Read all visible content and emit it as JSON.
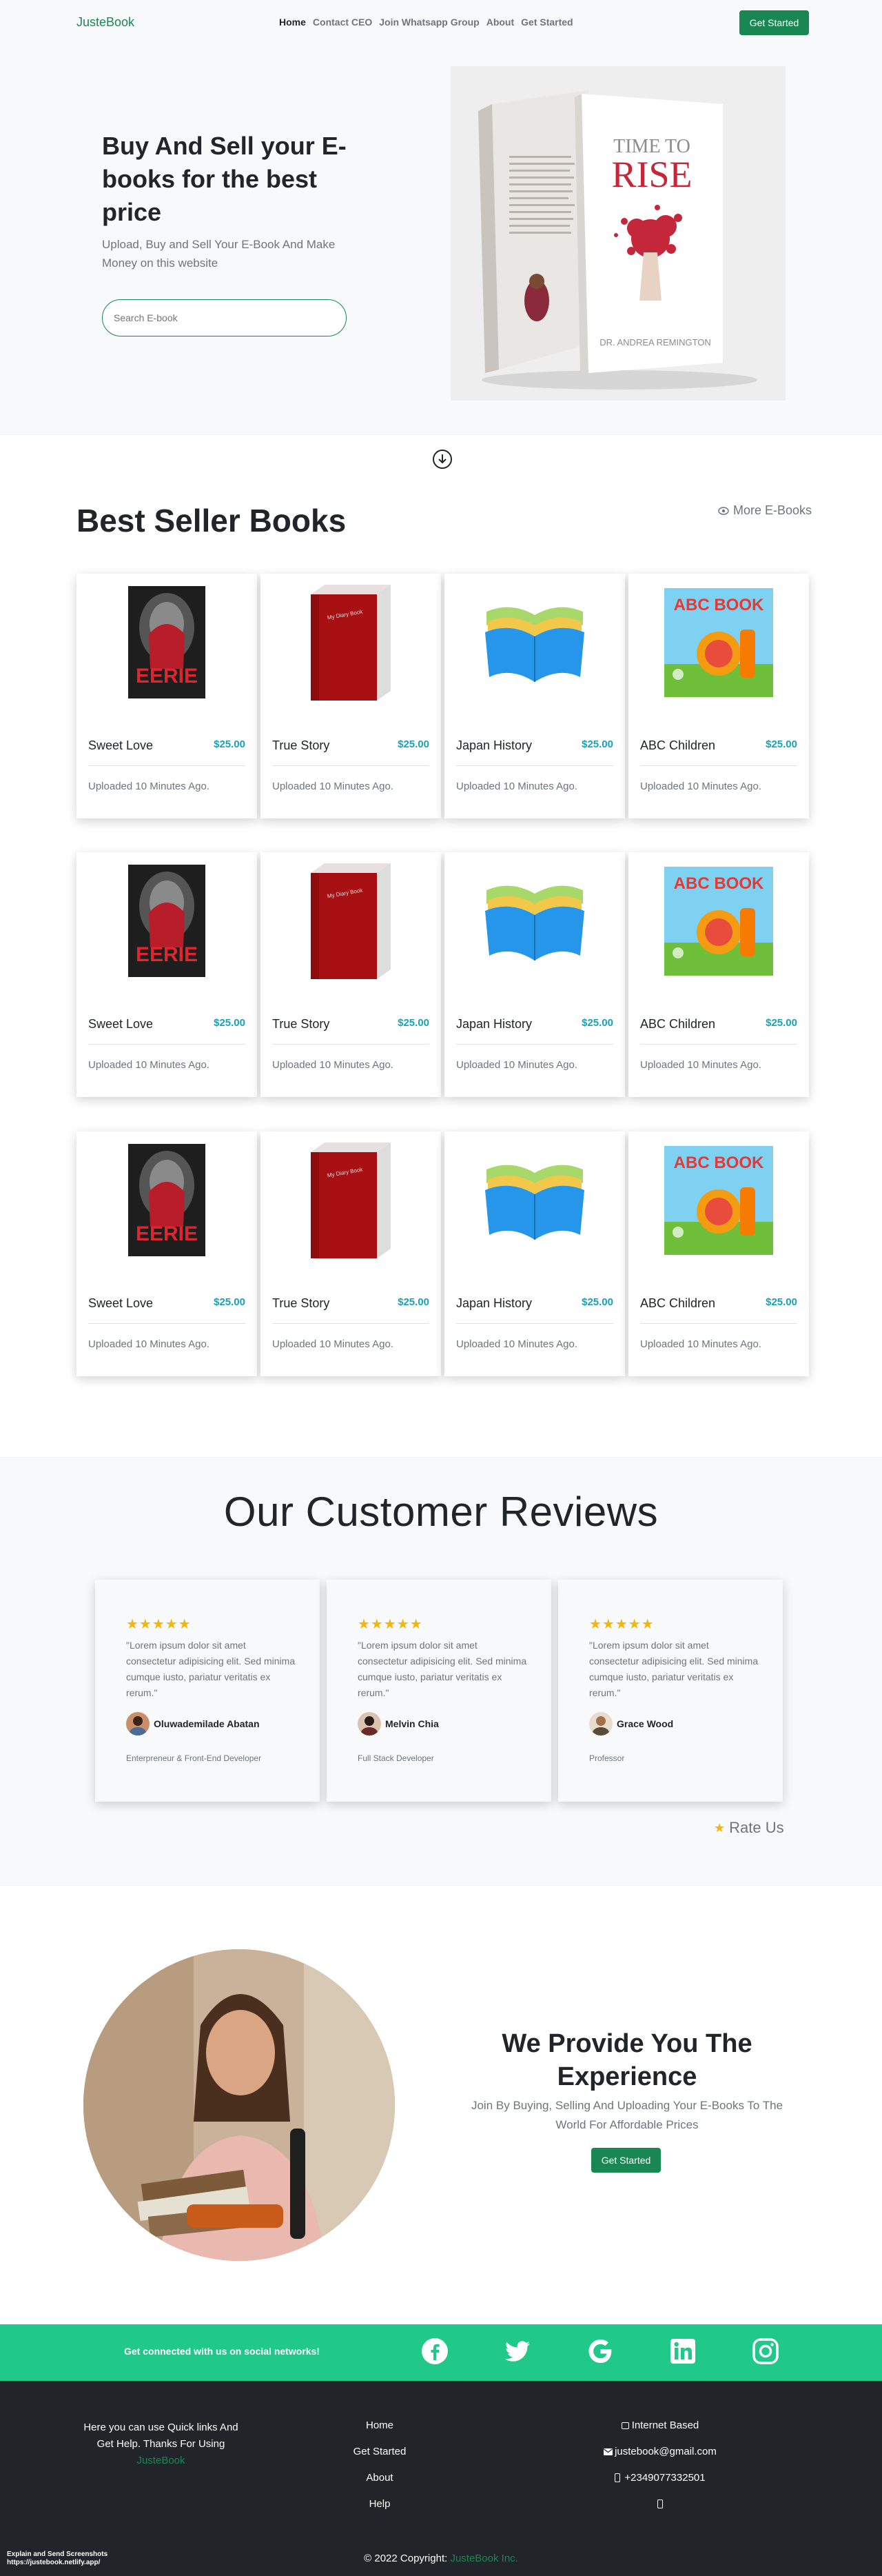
{
  "nav": {
    "brand": "JusteBook",
    "links": [
      "Home",
      "Contact CEO",
      "Join Whatsapp Group",
      "About",
      "Get Started"
    ],
    "cta": "Get Started"
  },
  "hero": {
    "title": "Buy And Sell your E-books for the best price",
    "subtitle": "Upload, Buy and Sell Your E-Book And Make Money on this website",
    "search_placeholder": "Search E-book",
    "book_cover_title_top": "TIME TO",
    "book_cover_title_main": "RISE",
    "book_cover_author": "DR. ANDREA REMINGTON"
  },
  "best_sellers": {
    "title": "Best Seller Books",
    "more_link": "More E-Books",
    "rows": [
      [
        {
          "name": "Sweet Love",
          "price": "$25.00",
          "uploaded": "Uploaded 10 Minutes Ago.",
          "cover": "eerie"
        },
        {
          "name": "True Story",
          "price": "$25.00",
          "uploaded": "Uploaded 10 Minutes Ago.",
          "cover": "red-book"
        },
        {
          "name": "Japan History",
          "price": "$25.00",
          "uploaded": "Uploaded 10 Minutes Ago.",
          "cover": "open-book"
        },
        {
          "name": "ABC Children",
          "price": "$25.00",
          "uploaded": "Uploaded 10 Minutes Ago.",
          "cover": "abc"
        }
      ],
      [
        {
          "name": "Sweet Love",
          "price": "$25.00",
          "uploaded": "Uploaded 10 Minutes Ago.",
          "cover": "eerie"
        },
        {
          "name": "True Story",
          "price": "$25.00",
          "uploaded": "Uploaded 10 Minutes Ago.",
          "cover": "red-book"
        },
        {
          "name": "Japan History",
          "price": "$25.00",
          "uploaded": "Uploaded 10 Minutes Ago.",
          "cover": "open-book"
        },
        {
          "name": "ABC Children",
          "price": "$25.00",
          "uploaded": "Uploaded 10 Minutes Ago.",
          "cover": "abc"
        }
      ],
      [
        {
          "name": "Sweet Love",
          "price": "$25.00",
          "uploaded": "Uploaded 10 Minutes Ago.",
          "cover": "eerie"
        },
        {
          "name": "True Story",
          "price": "$25.00",
          "uploaded": "Uploaded 10 Minutes Ago.",
          "cover": "red-book"
        },
        {
          "name": "Japan History",
          "price": "$25.00",
          "uploaded": "Uploaded 10 Minutes Ago.",
          "cover": "open-book"
        },
        {
          "name": "ABC Children",
          "price": "$25.00",
          "uploaded": "Uploaded 10 Minutes Ago.",
          "cover": "abc"
        }
      ]
    ],
    "cover_texts": {
      "eerie": "EERIE",
      "red_book": "My Diary Book",
      "abc": "ABC BOOK"
    }
  },
  "reviews": {
    "title": "Our Customer Reviews",
    "items": [
      {
        "stars": "★★★★★",
        "text": "\"Lorem ipsum dolor sit amet consectetur adipisicing elit. Sed minima cumque iusto, pariatur veritatis ex rerum.\"",
        "name": "Oluwademilade Abatan",
        "role": "Enterpreneur & Front-End Developer"
      },
      {
        "stars": "★★★★★",
        "text": "\"Lorem ipsum dolor sit amet consectetur adipisicing elit. Sed minima cumque iusto, pariatur veritatis ex rerum.\"",
        "name": "Melvin Chia",
        "role": "Full Stack Developer"
      },
      {
        "stars": "★★★★★",
        "text": "\"Lorem ipsum dolor sit amet consectetur adipisicing elit. Sed minima cumque iusto, pariatur veritatis ex rerum.\"",
        "name": "Grace Wood",
        "role": "Professor"
      }
    ],
    "rate_us": "Rate Us"
  },
  "experience": {
    "title": "We Provide You The Experience",
    "subtitle": "Join By Buying, Selling And Uploading Your E-Books To The World For Affordable Prices",
    "cta": "Get Started"
  },
  "social": {
    "text": "Get connected with us on social networks!",
    "icons": [
      "facebook-icon",
      "twitter-icon",
      "google-icon",
      "linkedin-icon",
      "instagram-icon"
    ]
  },
  "footer": {
    "about_text": "Here you can use Quick links And Get Help. Thanks For Using",
    "about_brand": "JusteBook",
    "links": [
      "Home",
      "Get Started",
      "About",
      "Help"
    ],
    "contact": {
      "location": "Internet Based",
      "email": "justebook@gmail.com",
      "phone": "+2349077332501"
    },
    "bottom_left_line1": "Explain and Send Screenshots",
    "bottom_left_line2": "https://justebook.netlify.app/",
    "copyright_prefix": "© 2022 Copyright:",
    "copyright_brand": "JusteBook Inc."
  },
  "colors": {
    "brand_green": "#198754",
    "social_bar": "#20c98a",
    "price": "#17a2b8",
    "star": "#f5b50a",
    "footer_bg": "#212529"
  }
}
